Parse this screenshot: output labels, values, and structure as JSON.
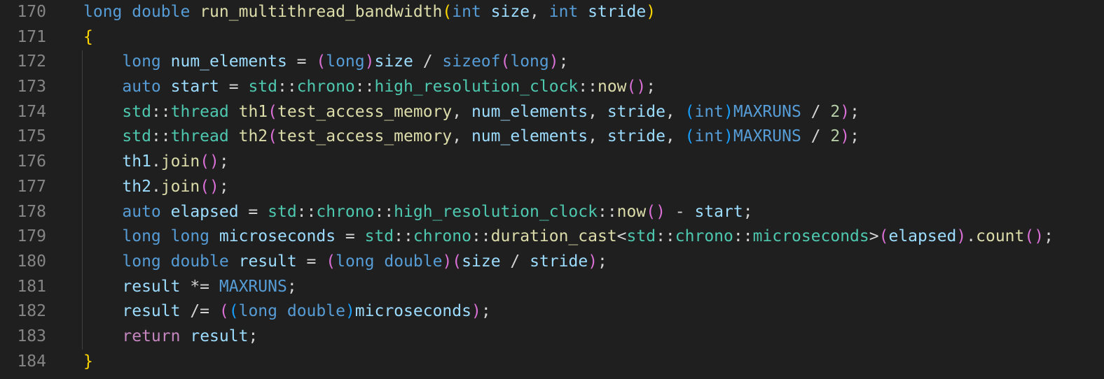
{
  "line_numbers": [
    "170",
    "171",
    "172",
    "173",
    "174",
    "175",
    "176",
    "177",
    "178",
    "179",
    "180",
    "181",
    "182",
    "183",
    "184"
  ],
  "lines": [
    [
      {
        "t": "long",
        "c": "kw"
      },
      {
        "t": " ",
        "c": "op"
      },
      {
        "t": "double",
        "c": "kw"
      },
      {
        "t": " ",
        "c": "op"
      },
      {
        "t": "run_multithread_bandwidth",
        "c": "fn"
      },
      {
        "t": "(",
        "c": "p1"
      },
      {
        "t": "int",
        "c": "kw"
      },
      {
        "t": " ",
        "c": "op"
      },
      {
        "t": "size",
        "c": "var"
      },
      {
        "t": ", ",
        "c": "op"
      },
      {
        "t": "int",
        "c": "kw"
      },
      {
        "t": " ",
        "c": "op"
      },
      {
        "t": "stride",
        "c": "var"
      },
      {
        "t": ")",
        "c": "p1"
      }
    ],
    [
      {
        "t": "{",
        "c": "p1"
      }
    ],
    [
      {
        "t": "    ",
        "c": "op"
      },
      {
        "t": "long",
        "c": "kw"
      },
      {
        "t": " ",
        "c": "op"
      },
      {
        "t": "num_elements",
        "c": "var"
      },
      {
        "t": " = ",
        "c": "op"
      },
      {
        "t": "(",
        "c": "p2"
      },
      {
        "t": "long",
        "c": "kw"
      },
      {
        "t": ")",
        "c": "p2"
      },
      {
        "t": "size",
        "c": "var"
      },
      {
        "t": " / ",
        "c": "op"
      },
      {
        "t": "sizeof",
        "c": "kw"
      },
      {
        "t": "(",
        "c": "p2"
      },
      {
        "t": "long",
        "c": "kw"
      },
      {
        "t": ")",
        "c": "p2"
      },
      {
        "t": ";",
        "c": "op"
      }
    ],
    [
      {
        "t": "    ",
        "c": "op"
      },
      {
        "t": "auto",
        "c": "kw"
      },
      {
        "t": " ",
        "c": "op"
      },
      {
        "t": "start",
        "c": "var"
      },
      {
        "t": " = ",
        "c": "op"
      },
      {
        "t": "std",
        "c": "ty"
      },
      {
        "t": "::",
        "c": "op"
      },
      {
        "t": "chrono",
        "c": "ty"
      },
      {
        "t": "::",
        "c": "op"
      },
      {
        "t": "high_resolution_clock",
        "c": "ty"
      },
      {
        "t": "::",
        "c": "op"
      },
      {
        "t": "now",
        "c": "fn"
      },
      {
        "t": "()",
        "c": "p2"
      },
      {
        "t": ";",
        "c": "op"
      }
    ],
    [
      {
        "t": "    ",
        "c": "op"
      },
      {
        "t": "std",
        "c": "ty"
      },
      {
        "t": "::",
        "c": "op"
      },
      {
        "t": "thread",
        "c": "ty"
      },
      {
        "t": " ",
        "c": "op"
      },
      {
        "t": "th1",
        "c": "fn"
      },
      {
        "t": "(",
        "c": "p2"
      },
      {
        "t": "test_access_memory",
        "c": "fn"
      },
      {
        "t": ", ",
        "c": "op"
      },
      {
        "t": "num_elements",
        "c": "var"
      },
      {
        "t": ", ",
        "c": "op"
      },
      {
        "t": "stride",
        "c": "var"
      },
      {
        "t": ", ",
        "c": "op"
      },
      {
        "t": "(",
        "c": "p3"
      },
      {
        "t": "int",
        "c": "kw"
      },
      {
        "t": ")",
        "c": "p3"
      },
      {
        "t": "MAXRUNS",
        "c": "mac"
      },
      {
        "t": " / ",
        "c": "op"
      },
      {
        "t": "2",
        "c": "num"
      },
      {
        "t": ")",
        "c": "p2"
      },
      {
        "t": ";",
        "c": "op"
      }
    ],
    [
      {
        "t": "    ",
        "c": "op"
      },
      {
        "t": "std",
        "c": "ty"
      },
      {
        "t": "::",
        "c": "op"
      },
      {
        "t": "thread",
        "c": "ty"
      },
      {
        "t": " ",
        "c": "op"
      },
      {
        "t": "th2",
        "c": "fn"
      },
      {
        "t": "(",
        "c": "p2"
      },
      {
        "t": "test_access_memory",
        "c": "fn"
      },
      {
        "t": ", ",
        "c": "op"
      },
      {
        "t": "num_elements",
        "c": "var"
      },
      {
        "t": ", ",
        "c": "op"
      },
      {
        "t": "stride",
        "c": "var"
      },
      {
        "t": ", ",
        "c": "op"
      },
      {
        "t": "(",
        "c": "p3"
      },
      {
        "t": "int",
        "c": "kw"
      },
      {
        "t": ")",
        "c": "p3"
      },
      {
        "t": "MAXRUNS",
        "c": "mac"
      },
      {
        "t": " / ",
        "c": "op"
      },
      {
        "t": "2",
        "c": "num"
      },
      {
        "t": ")",
        "c": "p2"
      },
      {
        "t": ";",
        "c": "op"
      }
    ],
    [
      {
        "t": "    ",
        "c": "op"
      },
      {
        "t": "th1",
        "c": "var"
      },
      {
        "t": ".",
        "c": "op"
      },
      {
        "t": "join",
        "c": "fn"
      },
      {
        "t": "()",
        "c": "p2"
      },
      {
        "t": ";",
        "c": "op"
      }
    ],
    [
      {
        "t": "    ",
        "c": "op"
      },
      {
        "t": "th2",
        "c": "var"
      },
      {
        "t": ".",
        "c": "op"
      },
      {
        "t": "join",
        "c": "fn"
      },
      {
        "t": "()",
        "c": "p2"
      },
      {
        "t": ";",
        "c": "op"
      }
    ],
    [
      {
        "t": "    ",
        "c": "op"
      },
      {
        "t": "auto",
        "c": "kw"
      },
      {
        "t": " ",
        "c": "op"
      },
      {
        "t": "elapsed",
        "c": "var"
      },
      {
        "t": " = ",
        "c": "op"
      },
      {
        "t": "std",
        "c": "ty"
      },
      {
        "t": "::",
        "c": "op"
      },
      {
        "t": "chrono",
        "c": "ty"
      },
      {
        "t": "::",
        "c": "op"
      },
      {
        "t": "high_resolution_clock",
        "c": "ty"
      },
      {
        "t": "::",
        "c": "op"
      },
      {
        "t": "now",
        "c": "fn"
      },
      {
        "t": "()",
        "c": "p2"
      },
      {
        "t": " - ",
        "c": "op"
      },
      {
        "t": "start",
        "c": "var"
      },
      {
        "t": ";",
        "c": "op"
      }
    ],
    [
      {
        "t": "    ",
        "c": "op"
      },
      {
        "t": "long",
        "c": "kw"
      },
      {
        "t": " ",
        "c": "op"
      },
      {
        "t": "long",
        "c": "kw"
      },
      {
        "t": " ",
        "c": "op"
      },
      {
        "t": "microseconds",
        "c": "var"
      },
      {
        "t": " = ",
        "c": "op"
      },
      {
        "t": "std",
        "c": "ty"
      },
      {
        "t": "::",
        "c": "op"
      },
      {
        "t": "chrono",
        "c": "ty"
      },
      {
        "t": "::",
        "c": "op"
      },
      {
        "t": "duration_cast",
        "c": "fn"
      },
      {
        "t": "<",
        "c": "op"
      },
      {
        "t": "std",
        "c": "ty"
      },
      {
        "t": "::",
        "c": "op"
      },
      {
        "t": "chrono",
        "c": "ty"
      },
      {
        "t": "::",
        "c": "op"
      },
      {
        "t": "microseconds",
        "c": "ty"
      },
      {
        "t": ">",
        "c": "op"
      },
      {
        "t": "(",
        "c": "p2"
      },
      {
        "t": "elapsed",
        "c": "var"
      },
      {
        "t": ")",
        "c": "p2"
      },
      {
        "t": ".",
        "c": "op"
      },
      {
        "t": "count",
        "c": "fn"
      },
      {
        "t": "()",
        "c": "p2"
      },
      {
        "t": ";",
        "c": "op"
      }
    ],
    [
      {
        "t": "    ",
        "c": "op"
      },
      {
        "t": "long",
        "c": "kw"
      },
      {
        "t": " ",
        "c": "op"
      },
      {
        "t": "double",
        "c": "kw"
      },
      {
        "t": " ",
        "c": "op"
      },
      {
        "t": "result",
        "c": "var"
      },
      {
        "t": " = ",
        "c": "op"
      },
      {
        "t": "(",
        "c": "p2"
      },
      {
        "t": "long",
        "c": "kw"
      },
      {
        "t": " ",
        "c": "op"
      },
      {
        "t": "double",
        "c": "kw"
      },
      {
        "t": ")",
        "c": "p2"
      },
      {
        "t": "(",
        "c": "p2"
      },
      {
        "t": "size",
        "c": "var"
      },
      {
        "t": " / ",
        "c": "op"
      },
      {
        "t": "stride",
        "c": "var"
      },
      {
        "t": ")",
        "c": "p2"
      },
      {
        "t": ";",
        "c": "op"
      }
    ],
    [
      {
        "t": "    ",
        "c": "op"
      },
      {
        "t": "result",
        "c": "var"
      },
      {
        "t": " *= ",
        "c": "op"
      },
      {
        "t": "MAXRUNS",
        "c": "mac"
      },
      {
        "t": ";",
        "c": "op"
      }
    ],
    [
      {
        "t": "    ",
        "c": "op"
      },
      {
        "t": "result",
        "c": "var"
      },
      {
        "t": " /= ",
        "c": "op"
      },
      {
        "t": "(",
        "c": "p2"
      },
      {
        "t": "(",
        "c": "p3"
      },
      {
        "t": "long",
        "c": "kw"
      },
      {
        "t": " ",
        "c": "op"
      },
      {
        "t": "double",
        "c": "kw"
      },
      {
        "t": ")",
        "c": "p3"
      },
      {
        "t": "microseconds",
        "c": "var"
      },
      {
        "t": ")",
        "c": "p2"
      },
      {
        "t": ";",
        "c": "op"
      }
    ],
    [
      {
        "t": "    ",
        "c": "op"
      },
      {
        "t": "return",
        "c": "ctl"
      },
      {
        "t": " ",
        "c": "op"
      },
      {
        "t": "result",
        "c": "var"
      },
      {
        "t": ";",
        "c": "op"
      }
    ],
    [
      {
        "t": "}",
        "c": "p1"
      }
    ]
  ]
}
